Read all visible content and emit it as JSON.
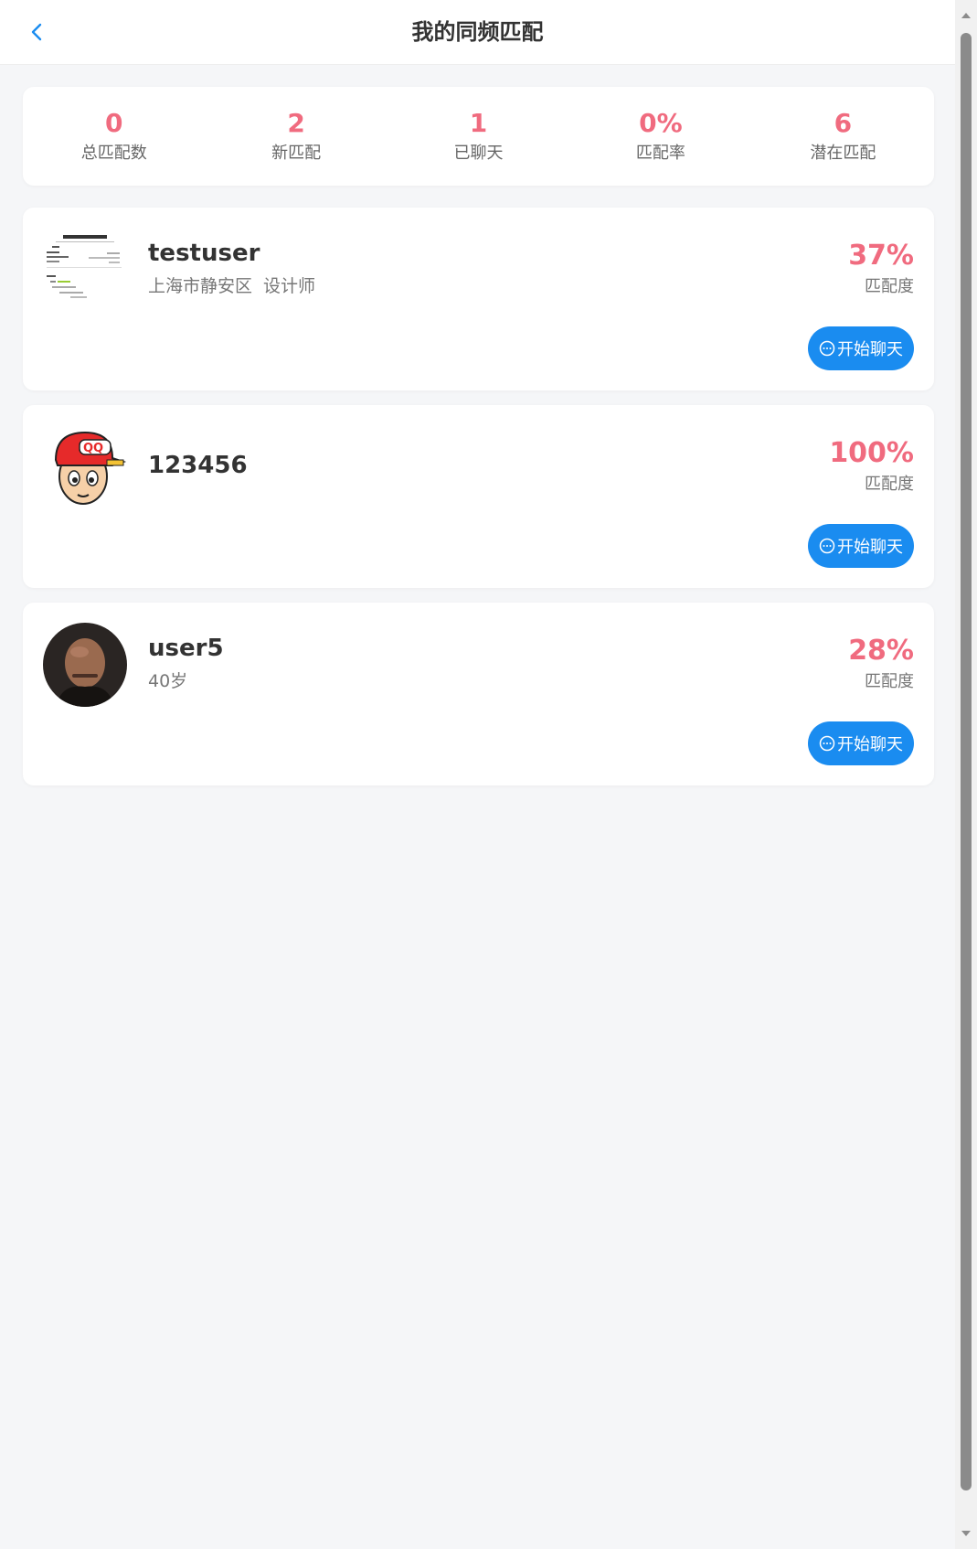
{
  "header": {
    "title": "我的同频匹配"
  },
  "stats": [
    {
      "value": "0",
      "label": "总匹配数"
    },
    {
      "value": "2",
      "label": "新匹配"
    },
    {
      "value": "1",
      "label": "已聊天"
    },
    {
      "value": "0%",
      "label": "匹配率"
    },
    {
      "value": "6",
      "label": "潜在匹配"
    }
  ],
  "matches": [
    {
      "name": "testuser",
      "location": "上海市静安区",
      "job": "设计师",
      "percent": "37%",
      "percent_label": "匹配度",
      "chat_label": "开始聊天",
      "avatar": "document-thumbnail"
    },
    {
      "name": "123456",
      "percent": "100%",
      "percent_label": "匹配度",
      "chat_label": "开始聊天",
      "avatar": "qq-cartoon-avatar"
    },
    {
      "name": "user5",
      "age": "40岁",
      "percent": "28%",
      "percent_label": "匹配度",
      "chat_label": "开始聊天",
      "avatar": "portrait-photo"
    }
  ],
  "colors": {
    "accent": "#f06b7f",
    "button": "#1a8cf0",
    "background": "#f5f6f8"
  },
  "icons": {
    "back": "chevron-left-icon",
    "chat": "chat-bubble-icon"
  }
}
